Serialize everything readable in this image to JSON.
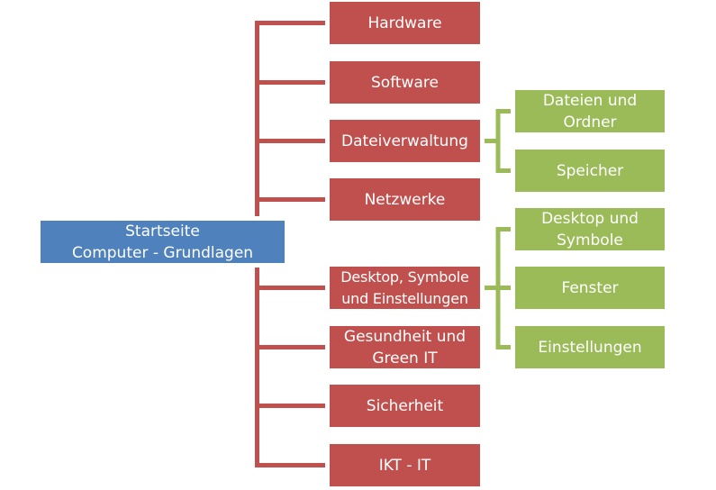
{
  "diagram": {
    "type": "hierarchy",
    "colors": {
      "root": "#4F81BD",
      "level1": "#C0504D",
      "level2": "#9BBB59",
      "text": "#FFFFFF"
    },
    "root": {
      "label": "Startseite\nComputer - Grundlagen"
    },
    "level1": [
      {
        "label": "Hardware"
      },
      {
        "label": "Software"
      },
      {
        "label": "Dateiverwaltung",
        "children": [
          "Dateien und\nOrdner",
          "Speicher"
        ]
      },
      {
        "label": "Netzwerke"
      },
      {
        "label": "Desktop, Symbole\nund Einstellungen",
        "children": [
          "Desktop und\nSymbole",
          "Fenster",
          "Einstellungen"
        ]
      },
      {
        "label": "Gesundheit und\nGreen IT"
      },
      {
        "label": "Sicherheit"
      },
      {
        "label": "IKT - IT"
      }
    ],
    "level2": {
      "dateiverwaltung": [
        {
          "label": "Dateien und\nOrdner"
        },
        {
          "label": "Speicher"
        }
      ],
      "desktop": [
        {
          "label": "Desktop und\nSymbole"
        },
        {
          "label": "Fenster"
        },
        {
          "label": "Einstellungen"
        }
      ]
    }
  }
}
